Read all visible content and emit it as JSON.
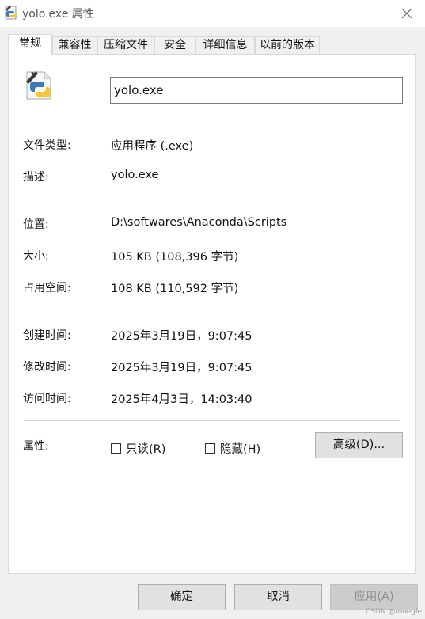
{
  "window": {
    "title": "yolo.exe 属性"
  },
  "tabs": [
    {
      "label": "常规"
    },
    {
      "label": "兼容性"
    },
    {
      "label": "压缩文件"
    },
    {
      "label": "安全"
    },
    {
      "label": "详细信息"
    },
    {
      "label": "以前的版本"
    }
  ],
  "general": {
    "filename": "yolo.exe",
    "file_type_label": "文件类型:",
    "file_type_value": "应用程序 (.exe)",
    "description_label": "描述:",
    "description_value": "yolo.exe",
    "location_label": "位置:",
    "location_value": "D:\\softwares\\Anaconda\\Scripts",
    "size_label": "大小:",
    "size_value": "105 KB (108,396 字节)",
    "size_on_disk_label": "占用空间:",
    "size_on_disk_value": "108 KB (110,592 字节)",
    "created_label": "创建时间:",
    "created_value": "2025年3月19日，9:07:45",
    "modified_label": "修改时间:",
    "modified_value": "2025年3月19日，9:07:45",
    "accessed_label": "访问时间:",
    "accessed_value": "2025年4月3日，14:03:40",
    "attributes_label": "属性:",
    "readonly_label": "只读(R)",
    "readonly_checked": false,
    "hidden_label": "隐藏(H)",
    "hidden_checked": false,
    "advanced_button": "高级(D)..."
  },
  "footer": {
    "ok": "确定",
    "cancel": "取消",
    "apply": "应用(A)"
  },
  "watermark": "CSDN @moegle"
}
